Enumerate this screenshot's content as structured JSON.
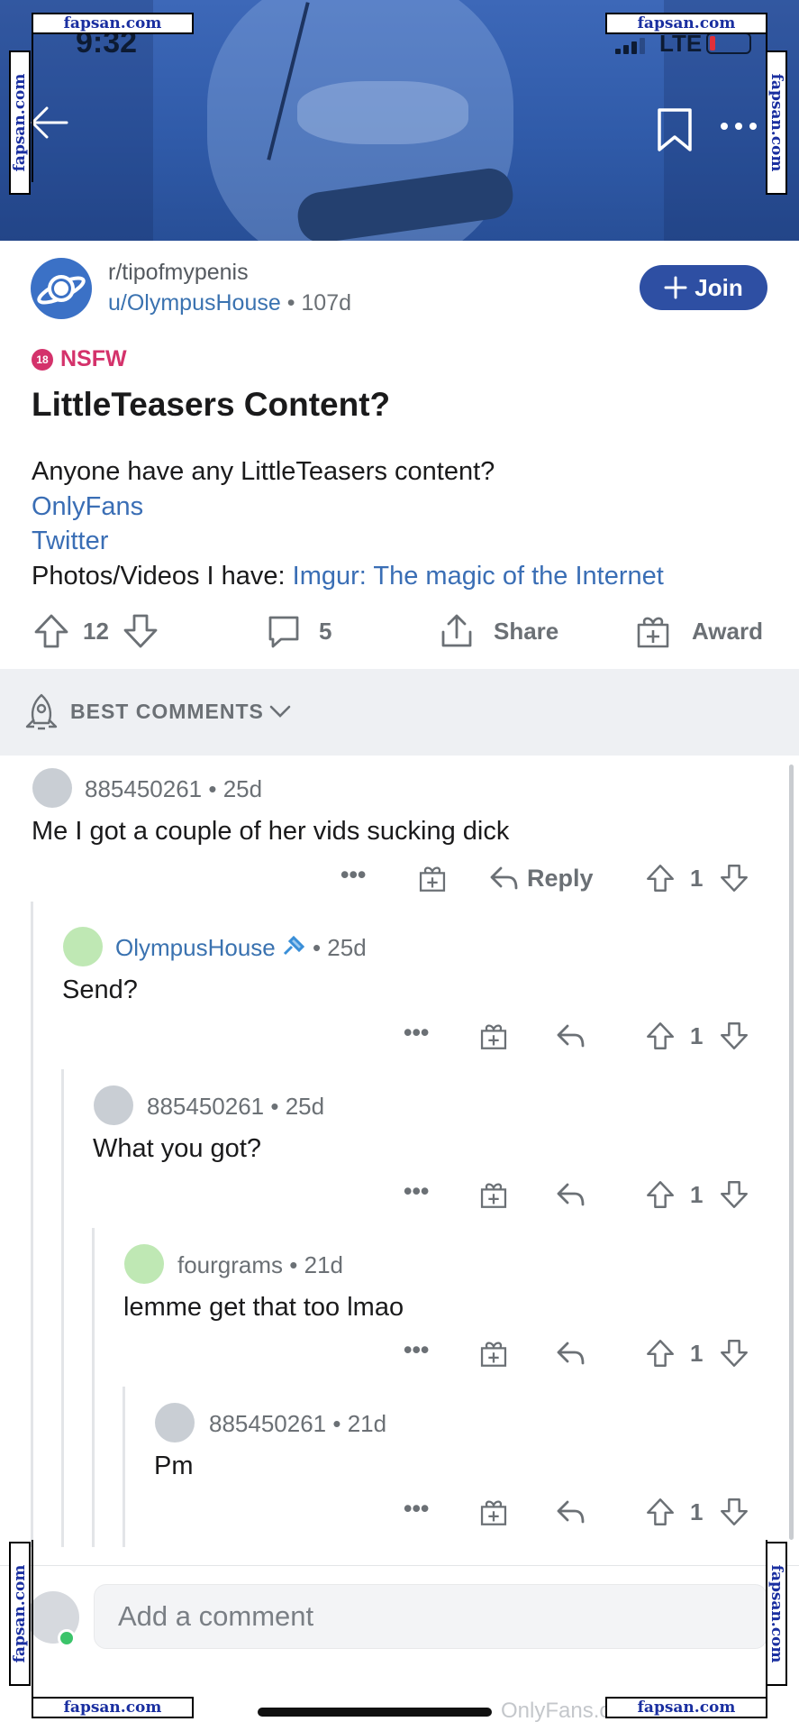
{
  "status_bar": {
    "time": "9:32",
    "network": "LTE"
  },
  "watermark": {
    "text": "fapsan.com"
  },
  "post": {
    "subreddit": "r/tipofmypenis",
    "author": "u/OlympusHouse",
    "age": "107d",
    "join_label": "Join",
    "nsfw_label": "NSFW",
    "nsfw_badge": "18",
    "title": "LittleTeasers Content?",
    "body_line1": "Anyone have any LittleTeasers content?",
    "link_onlyfans": "OnlyFans",
    "link_twitter": "Twitter",
    "body_line4_prefix": "Photos/Videos I have: ",
    "link_imgur": "Imgur: The magic of the Internet",
    "upvotes": "12",
    "comments": "5",
    "share_label": "Share",
    "award_label": "Award"
  },
  "sort": {
    "label": "BEST COMMENTS"
  },
  "comments": [
    {
      "user": "885450261",
      "age": "25d",
      "text": "Me I got a couple of her vids sucking dick",
      "votes": "1",
      "reply_label": "Reply",
      "is_op": false
    },
    {
      "user": "OlympusHouse",
      "age": "25d",
      "text": "Send?",
      "votes": "1",
      "is_op": true
    },
    {
      "user": "885450261",
      "age": "25d",
      "text": "What you got?",
      "votes": "1",
      "is_op": false
    },
    {
      "user": "fourgrams",
      "age": "21d",
      "text": "lemme get that too lmao",
      "votes": "1",
      "is_op": false
    },
    {
      "user": "885450261",
      "age": "21d",
      "text": "Pm",
      "votes": "1",
      "is_op": false
    }
  ],
  "composer": {
    "placeholder": "Add a comment"
  },
  "bottom_watermark": "OnlyFans.ce LittleTeasers",
  "colors": {
    "accent": "#2e4fa3",
    "nsfw": "#d4326b",
    "link": "#3a6eb5",
    "muted": "#6b7075"
  }
}
